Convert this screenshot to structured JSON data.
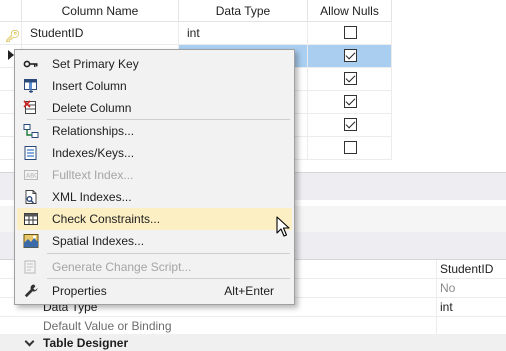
{
  "grid": {
    "columns": [
      "Column Name",
      "Data Type",
      "Allow Nulls"
    ],
    "rows": [
      {
        "name": "StudentID",
        "type": "int",
        "allow_nulls": false,
        "primary_key": true
      },
      {
        "name": "",
        "type": "",
        "allow_nulls": true,
        "selected": true
      },
      {
        "name": "",
        "type": "",
        "allow_nulls": true
      },
      {
        "name": "",
        "type": "",
        "allow_nulls": true
      },
      {
        "name": "",
        "type": "",
        "allow_nulls": true
      },
      {
        "name": "",
        "type": "",
        "allow_nulls": false
      }
    ]
  },
  "context_menu": {
    "items": [
      {
        "label": "Set Primary Key",
        "icon": "key-icon",
        "enabled": true
      },
      {
        "label": "Insert Column",
        "icon": "insert-column-icon",
        "enabled": true
      },
      {
        "label": "Delete Column",
        "icon": "delete-column-icon",
        "enabled": true
      },
      {
        "label": "Relationships...",
        "icon": "relationships-icon",
        "enabled": true
      },
      {
        "label": "Indexes/Keys...",
        "icon": "indexes-icon",
        "enabled": true
      },
      {
        "label": "Fulltext Index...",
        "icon": "fulltext-icon",
        "enabled": false
      },
      {
        "label": "XML Indexes...",
        "icon": "xml-icon",
        "enabled": true
      },
      {
        "label": "Check Constraints...",
        "icon": "check-constraints-icon",
        "enabled": true,
        "hover": true
      },
      {
        "label": "Spatial Indexes...",
        "icon": "spatial-icon",
        "enabled": true
      },
      {
        "label": "Generate Change Script...",
        "icon": "script-icon",
        "enabled": false
      },
      {
        "label": "Properties",
        "icon": "wrench-icon",
        "enabled": true,
        "shortcut": "Alt+Enter"
      }
    ]
  },
  "properties": {
    "rows": [
      {
        "name": "",
        "value": "StudentID",
        "muted": false
      },
      {
        "name": "",
        "value": "No",
        "muted": true
      },
      {
        "name": "Data Type",
        "value": "int",
        "muted": false
      },
      {
        "name": "Default Value or Binding",
        "value": "",
        "muted": true
      }
    ],
    "category": "Table Designer"
  },
  "colors": {
    "selection": "#a9cef0",
    "menu_hover": "#fcefc3",
    "menu_bg": "#f2f2f2"
  }
}
